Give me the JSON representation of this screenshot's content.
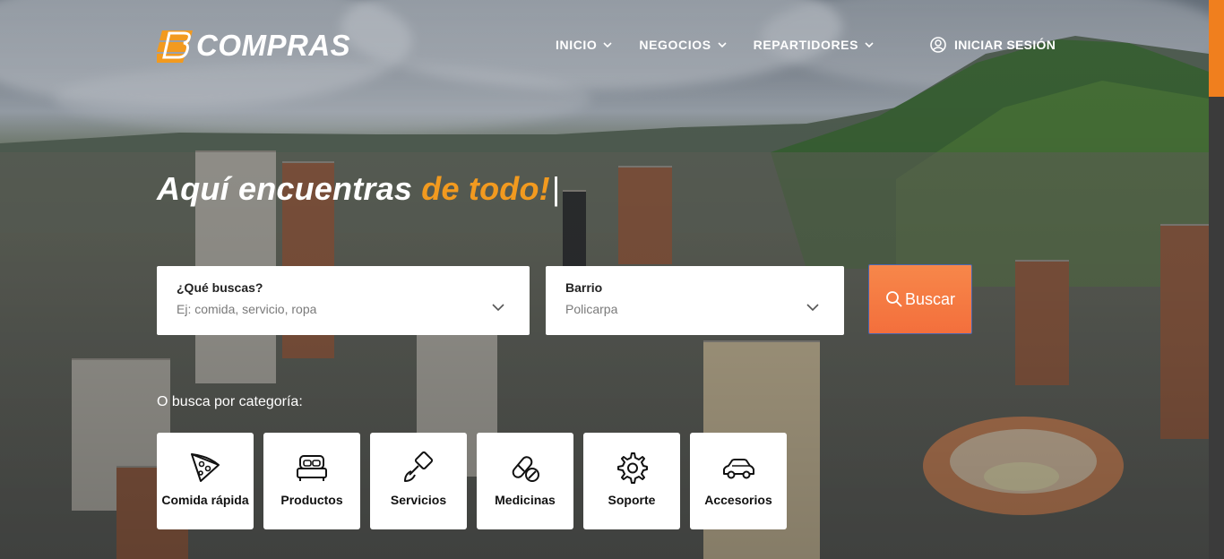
{
  "brand": {
    "name": "COMPRAS",
    "accent_color": "#f29a1f",
    "logo_icon": "b-logo-icon"
  },
  "nav": {
    "items": [
      {
        "label": "INICIO"
      },
      {
        "label": "NEGOCIOS"
      },
      {
        "label": "REPARTIDORES"
      }
    ],
    "login_label": "INICIAR SESIÓN"
  },
  "hero": {
    "headline_main": "Aquí encuentras ",
    "headline_accent": "de todo!",
    "headline_cursor": "|"
  },
  "search": {
    "what_label": "¿Qué buscas?",
    "what_placeholder": "Ej: comida, servicio, ropa",
    "barrio_label": "Barrio",
    "barrio_value": "Policarpa",
    "button_label": "Buscar",
    "button_color": "#f36f3c"
  },
  "categories": {
    "title": "O busca por categoría:",
    "items": [
      {
        "label": "Comida rápida",
        "icon": "pizza-icon"
      },
      {
        "label": "Productos",
        "icon": "bed-icon"
      },
      {
        "label": "Servicios",
        "icon": "paint-brush-icon"
      },
      {
        "label": "Medicinas",
        "icon": "pills-icon"
      },
      {
        "label": "Soporte",
        "icon": "gear-icon"
      },
      {
        "label": "Accesorios",
        "icon": "car-icon"
      }
    ]
  }
}
